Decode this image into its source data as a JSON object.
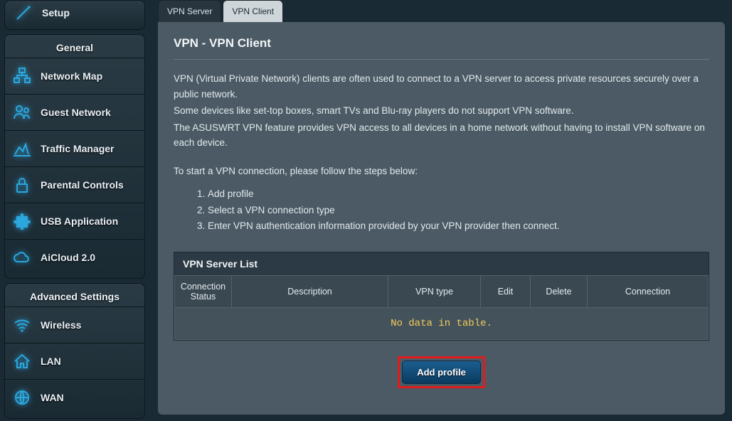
{
  "sidebar": {
    "setup_label": "Setup",
    "general": {
      "heading": "General",
      "items": [
        {
          "label": "Network Map",
          "name": "sidebar-item-network-map",
          "icon": "network-icon"
        },
        {
          "label": "Guest Network",
          "name": "sidebar-item-guest-network",
          "icon": "guest-icon"
        },
        {
          "label": "Traffic Manager",
          "name": "sidebar-item-traffic-manager",
          "icon": "traffic-icon"
        },
        {
          "label": "Parental Controls",
          "name": "sidebar-item-parental-controls",
          "icon": "lock-icon"
        },
        {
          "label": "USB Application",
          "name": "sidebar-item-usb-application",
          "icon": "puzzle-icon"
        },
        {
          "label": "AiCloud 2.0",
          "name": "sidebar-item-aicloud",
          "icon": "cloud-icon"
        }
      ]
    },
    "advanced": {
      "heading": "Advanced Settings",
      "items": [
        {
          "label": "Wireless",
          "name": "sidebar-item-wireless",
          "icon": "wifi-icon"
        },
        {
          "label": "LAN",
          "name": "sidebar-item-lan",
          "icon": "home-icon"
        },
        {
          "label": "WAN",
          "name": "sidebar-item-wan",
          "icon": "globe-icon"
        }
      ]
    }
  },
  "tabs": {
    "server": "VPN Server",
    "client": "VPN Client"
  },
  "page": {
    "title": "VPN - VPN Client",
    "para1": "VPN (Virtual Private Network) clients are often used to connect to a VPN server to access private resources securely over a public network.",
    "para2": "Some devices like set-top boxes, smart TVs and Blu-ray players do not support VPN software.",
    "para3": "The ASUSWRT VPN feature provides VPN access to all devices in a home network without having to install VPN software on each device.",
    "para4": "To start a VPN connection, please follow the steps below:",
    "steps": [
      "Add profile",
      "Select a VPN connection type",
      "Enter VPN authentication information provided by your VPN provider then connect."
    ],
    "table": {
      "title": "VPN Server List",
      "headers": {
        "conn_status": "Connection Status",
        "description": "Description",
        "vpn_type": "VPN type",
        "edit": "Edit",
        "delete": "Delete",
        "connection": "Connection"
      },
      "empty": "No data in table."
    },
    "add_profile_btn": "Add profile"
  }
}
